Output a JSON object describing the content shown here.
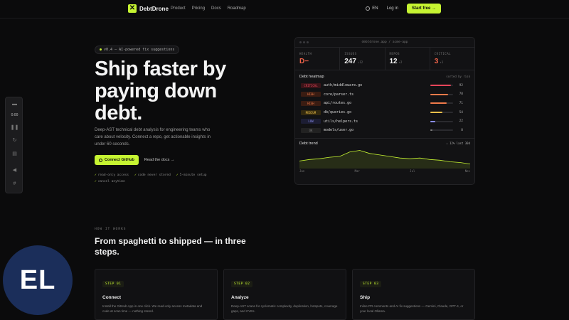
{
  "nav": {
    "brand": "DebtDrone",
    "links": [
      "Product",
      "Pricing",
      "Docs",
      "Roadmap"
    ],
    "lang": "EN",
    "login": "Log in",
    "start": "Start free →"
  },
  "hero": {
    "tag": "v0.4 — AI-powered fix suggestions",
    "title": "Ship faster by paying down debt.",
    "description": "Deep-AST technical debt analysis for engineering teams who care about velocity. Connect a repo, get actionable insights in under 60 seconds.",
    "cta_primary": "Connect GitHub",
    "cta_secondary": "Read the docs →",
    "checks": [
      "read-only access",
      "code never stored",
      "5-minute setup",
      "cancel anytime"
    ]
  },
  "dashboard": {
    "url": "debtdrone.app / acme-app",
    "stats": [
      {
        "label": "HEALTH",
        "value": "D−",
        "sub": "",
        "color": "#f0634a"
      },
      {
        "label": "ISSUES",
        "value": "247",
        "sub": "↓12",
        "color": "#f2f2f2"
      },
      {
        "label": "REPOS",
        "value": "12",
        "sub": "↑2",
        "color": "#f2f2f2"
      },
      {
        "label": "CRITICAL",
        "value": "3",
        "sub": "↑1",
        "color": "#f0634a"
      }
    ],
    "heatmap_title": "Debt heatmap",
    "heatmap_sort": "sorted by risk",
    "rows": [
      {
        "severity": "CRITICAL",
        "path": "auth/middleware.go",
        "score": "92",
        "pct": 0.92,
        "color": "#e8455a",
        "bg": "#3a1418"
      },
      {
        "severity": "HIGH",
        "path": "core/parser.ts",
        "score": "78",
        "pct": 0.78,
        "color": "#f07a4a",
        "bg": "#3a1c12"
      },
      {
        "severity": "HIGH",
        "path": "api/routes.go",
        "score": "71",
        "pct": 0.71,
        "color": "#f07a4a",
        "bg": "#3a1c12"
      },
      {
        "severity": "MEDIUM",
        "path": "db/queries.go",
        "score": "54",
        "pct": 0.54,
        "color": "#f0c04a",
        "bg": "#33290f"
      },
      {
        "severity": "LOW",
        "path": "utils/helpers.ts",
        "score": "22",
        "pct": 0.22,
        "color": "#8a8ef0",
        "bg": "#1c1d33"
      },
      {
        "severity": "OK",
        "path": "models/user.go",
        "score": "8",
        "pct": 0.08,
        "color": "#7a7a7a",
        "bg": "#222"
      }
    ],
    "trend_title": "Debt trend",
    "trend_delta": "↓ 12% last 30d",
    "trend_axis": [
      "Jan",
      "Mar",
      "Jul",
      "Nov"
    ],
    "trend_values": [
      10,
      12,
      13,
      15,
      16,
      22,
      24,
      20,
      18,
      16,
      14,
      13,
      14,
      12,
      11,
      9,
      8,
      6
    ]
  },
  "player": {
    "time": "0:00"
  },
  "how": {
    "label": "HOW IT WORKS",
    "title": "From spaghetti to shipped — in three steps.",
    "steps": [
      {
        "num": "STEP 01",
        "title": "Connect",
        "desc": "Install the GitHub App in one click. We read-only access metadata and code at scan time — nothing stored."
      },
      {
        "num": "STEP 02",
        "title": "Analyze",
        "desc": "Deep-AST scans for cyclomatic complexity, duplication, hotspots, coverage gaps, and CVEs."
      },
      {
        "num": "STEP 03",
        "title": "Ship",
        "desc": "Inline PR comments and AI fix suggestions — Gemini, Claude, GPT-4, or your local Ollama."
      }
    ]
  },
  "avatar": {
    "initials": "EL"
  }
}
